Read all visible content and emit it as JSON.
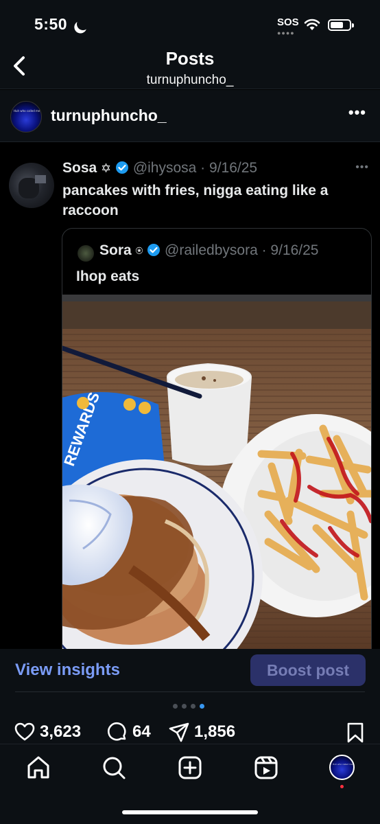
{
  "status_bar": {
    "time": "5:50",
    "carrier": "SOS"
  },
  "header": {
    "title": "Posts",
    "username": "turnuphuncho_"
  },
  "author": {
    "username": "turnuphuncho_",
    "avatar_text": "Huh who called me?"
  },
  "tweet": {
    "name": "Sosa",
    "handle_date": "@ihysosa · 9/16/25",
    "text": "pancakes with fries, nigga eating like a raccoon"
  },
  "quote": {
    "name": "Sora",
    "handle_date": "@railedbysora · 9/16/25",
    "text": "Ihop eats",
    "placemat_text": "REWARDS"
  },
  "actions": {
    "insights_label": "View insights",
    "boost_label": "Boost post",
    "likes": "3,623",
    "comments": "64",
    "shares": "1,856",
    "carousel_total": 4,
    "carousel_active": 4
  },
  "nav": {
    "items": [
      "home-icon",
      "search-icon",
      "create-icon",
      "reels-icon",
      "profile-avatar"
    ]
  },
  "colors": {
    "accent_link": "#7b9cf7",
    "boost_bg": "#2b3169",
    "verified": "#1d9bf0",
    "carousel_active": "#3897f0",
    "notification": "#ff3040"
  }
}
